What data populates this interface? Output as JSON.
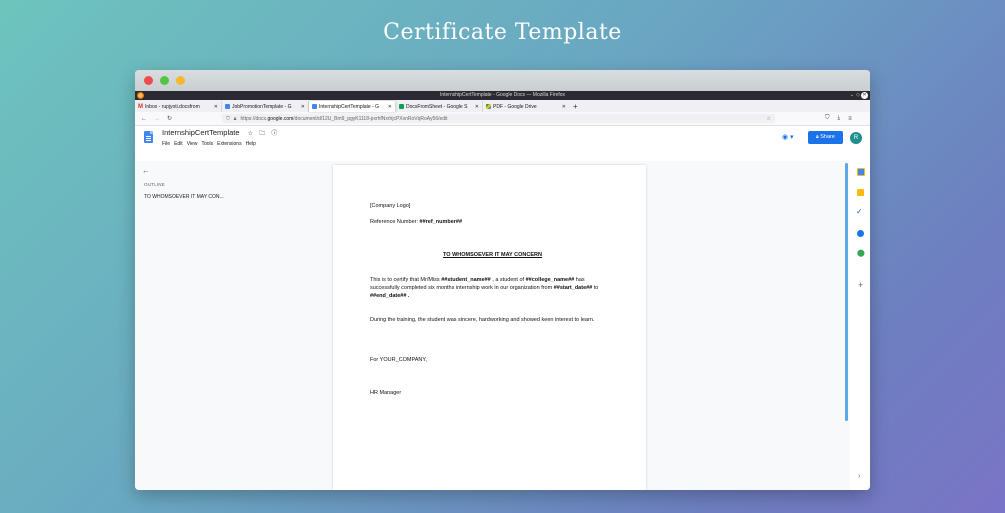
{
  "hero": {
    "title": "Certificate Template"
  },
  "browser": {
    "window_title": "InternshipCertTemplate - Google Docs — Mozilla Firefox",
    "tabs": [
      {
        "label": "Inbox - rupjyoti.docsfrom",
        "color": "#d93025",
        "active": false
      },
      {
        "label": "JobPromotionTemplate - G",
        "color": "#4285f4",
        "active": false
      },
      {
        "label": "InternshipCertTemplate - G",
        "color": "#4285f4",
        "active": true
      },
      {
        "label": "DocsFromSheet - Google S",
        "color": "#0f9d58",
        "active": false
      },
      {
        "label": "PDF - Google Drive",
        "color": "#fbbc04",
        "active": false
      }
    ],
    "url_prefix": "https://docs.",
    "url_domain": "google.com",
    "url_rest": "/document/d/12U_Bm9_pgyK1118-pxrhfNxrhjcPXxnRoVqRoAy56/edit"
  },
  "docs": {
    "title": "InternshipCertTemplate",
    "menu": [
      "File",
      "Edit",
      "View",
      "Tools",
      "Extensions",
      "Help"
    ],
    "share_label": "Share",
    "avatar_letter": "R"
  },
  "outline": {
    "heading": "OUTLINE",
    "item": "TO WHOMSOEVER IT MAY CON..."
  },
  "document": {
    "logo_placeholder": "[Company Logo]",
    "ref_label": "Reference Number: ",
    "ref_value": "##ref_number##",
    "heading": "TO WHOMSOEVER IT MAY CONCERN",
    "p1_a": "This is to certify that Mr/Miss ",
    "p1_b": "##student_name##",
    "p1_c": " , a student of ",
    "p1_d": "##college_name##",
    "p1_e": " has successfully completed six months internship work in our organization from ",
    "p1_f": "##start_date##",
    "p1_g": " to ",
    "p1_h": "##end_date##",
    "p1_i": " .",
    "p2": "During the training, the student was sincere, hardworking and showed keen interest to learn.",
    "p3": "For YOUR_COMPANY,",
    "p4": "HR Manager"
  },
  "colors": {
    "share_button": "#1a73e8",
    "avatar": "#1e8e8e",
    "scrollbar": "#5aa9e6"
  }
}
